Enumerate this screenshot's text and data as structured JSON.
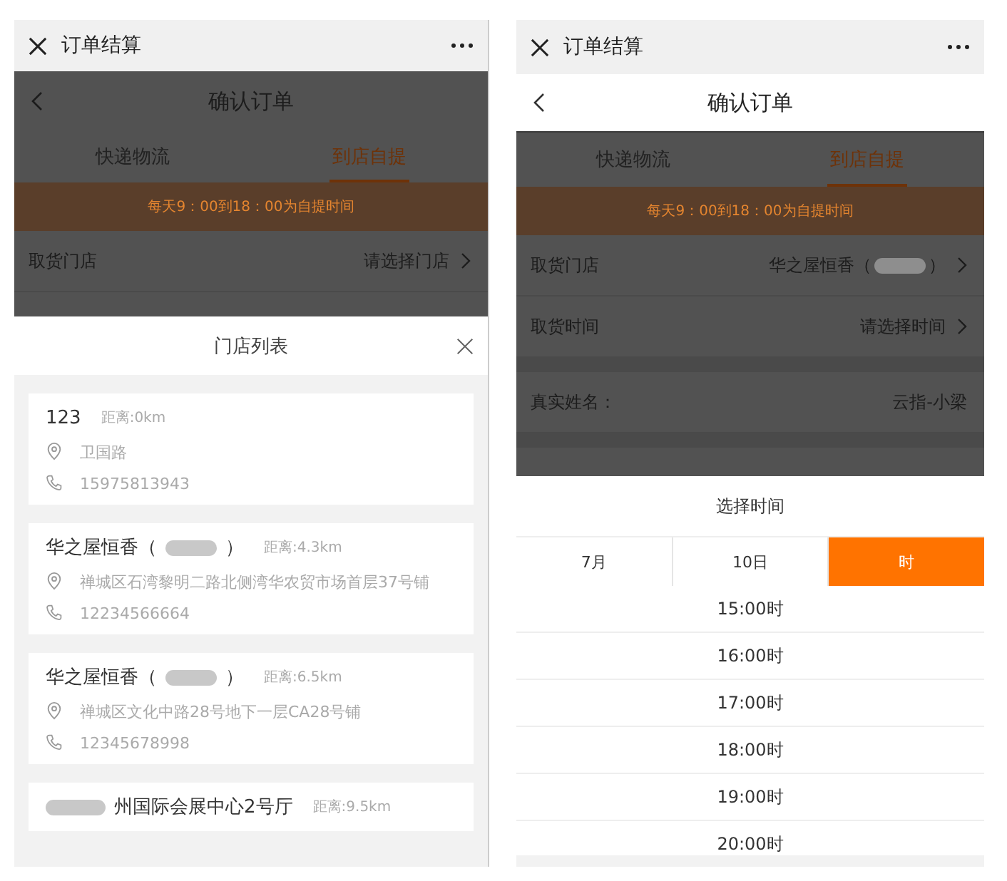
{
  "left_screen": {
    "window": {
      "title": "订单结算"
    },
    "nav": {
      "title": "确认订单"
    },
    "tabs": [
      {
        "label": "快递物流",
        "selected": false
      },
      {
        "label": "到店自提",
        "selected": true
      }
    ],
    "notice": "每天9：00到18：00为自提时间",
    "rows": [
      {
        "label": "取货门店",
        "value": "请选择门店",
        "redacted": false,
        "chevron": true
      }
    ],
    "store_list": {
      "title": "门店列表",
      "stores": [
        {
          "name_start": "123",
          "redacted": false,
          "distance": "距离:0km",
          "address": "卫国路",
          "phone": "15975813943"
        },
        {
          "name_start": "华之屋恒香（",
          "redacted": true,
          "name_end": "）",
          "distance": "距离:4.3km",
          "address": "禅城区石湾黎明二路北侧湾华农贸市场首层37号铺",
          "phone": "12234566664"
        },
        {
          "name_start": "华之屋恒香（",
          "redacted": true,
          "name_end": "）",
          "distance": "距离:6.5km",
          "address": "禅城区文化中路28号地下一层CA28号铺",
          "phone": "12345678998"
        },
        {
          "redacted": true,
          "name_end": "州国际会展中心2号厅",
          "distance": "距离:9.5km"
        }
      ]
    }
  },
  "right_screen": {
    "window": {
      "title": "订单结算"
    },
    "nav": {
      "title": "确认订单"
    },
    "tabs": [
      {
        "label": "快递物流",
        "selected": false
      },
      {
        "label": "到店自提",
        "selected": true
      }
    ],
    "notice": "每天9：00到18：00为自提时间",
    "sections": [
      [
        {
          "label": "取货门店",
          "value": "华之屋恒香（",
          "redacted": true,
          "value_end": "）",
          "chevron": true
        },
        {
          "label": "取货时间",
          "value": "请选择时间",
          "redacted": false,
          "chevron": true
        }
      ],
      [
        {
          "label": "真实姓名：",
          "value": "云指-小梁",
          "redacted": false,
          "chevron": false
        }
      ]
    ],
    "time_picker": {
      "title": "选择时间",
      "tabs": [
        {
          "label": "7月",
          "selected": false
        },
        {
          "label": "10日",
          "selected": false
        },
        {
          "label": "时",
          "selected": true
        }
      ],
      "times": [
        "15:00时",
        "16:00时",
        "17:00时",
        "18:00时",
        "19:00时",
        "20:00时"
      ]
    }
  }
}
